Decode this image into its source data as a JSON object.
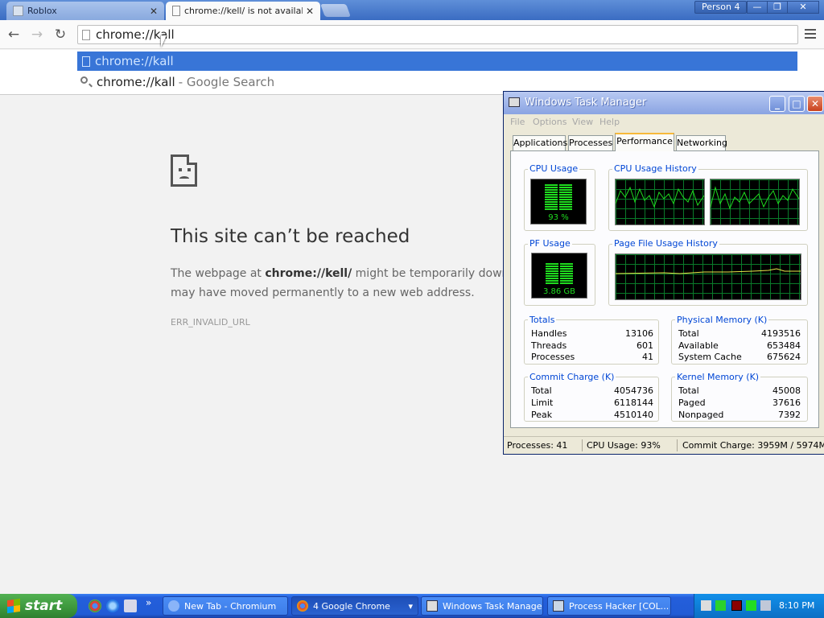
{
  "browser": {
    "tabs": [
      {
        "title": "Roblox",
        "active": false
      },
      {
        "title": "chrome://kell/ is not available",
        "active": true
      }
    ],
    "profile": "Person 4",
    "window_buttons": {
      "minimize": "—",
      "restore": "❐",
      "close": "✕"
    },
    "nav": {
      "back": "←",
      "forward": "→",
      "reload": "↻"
    },
    "omnibox_value": "chrome://kall",
    "suggestions": [
      {
        "text": "chrome://kall",
        "suffix": ""
      },
      {
        "text": "chrome://kall",
        "suffix": "- Google Search"
      }
    ]
  },
  "error_page": {
    "title": "This site can’t be reached",
    "body_prefix": "The webpage at ",
    "url": "chrome://kell/",
    "body_suffix": " might be temporarily down or it may have moved permanently to a new web address.",
    "code": "ERR_INVALID_URL"
  },
  "task_manager": {
    "title": "Windows Task Manager",
    "menu": [
      "File",
      "Options",
      "View",
      "Help"
    ],
    "tabs": [
      "Applications",
      "Processes",
      "Performance",
      "Networking"
    ],
    "active_tab": "Performance",
    "cpu_usage_title": "CPU Usage",
    "cpu_usage_value": "93 %",
    "cpu_history_title": "CPU Usage History",
    "pf_usage_title": "PF Usage",
    "pf_usage_value": "3.86 GB",
    "pf_history_title": "Page File Usage History",
    "totals": {
      "title": "Totals",
      "rows": [
        {
          "label": "Handles",
          "value": "13106"
        },
        {
          "label": "Threads",
          "value": "601"
        },
        {
          "label": "Processes",
          "value": "41"
        }
      ]
    },
    "physical_memory": {
      "title": "Physical Memory (K)",
      "rows": [
        {
          "label": "Total",
          "value": "4193516"
        },
        {
          "label": "Available",
          "value": "653484"
        },
        {
          "label": "System Cache",
          "value": "675624"
        }
      ]
    },
    "commit_charge": {
      "title": "Commit Charge (K)",
      "rows": [
        {
          "label": "Total",
          "value": "4054736"
        },
        {
          "label": "Limit",
          "value": "6118144"
        },
        {
          "label": "Peak",
          "value": "4510140"
        }
      ]
    },
    "kernel_memory": {
      "title": "Kernel Memory (K)",
      "rows": [
        {
          "label": "Total",
          "value": "45008"
        },
        {
          "label": "Paged",
          "value": "37616"
        },
        {
          "label": "Nonpaged",
          "value": "7392"
        }
      ]
    },
    "status": {
      "processes": "Processes: 41",
      "cpu": "CPU Usage: 93%",
      "commit": "Commit Charge: 3959M / 5974M"
    }
  },
  "taskbar": {
    "start_label": "start",
    "overflow": "»",
    "tasks": [
      {
        "label": "New Tab - Chromium",
        "pressed": false
      },
      {
        "label": "4 Google Chrome",
        "pressed": true
      },
      {
        "label": "Windows Task Manager",
        "pressed": false
      },
      {
        "label": "Process Hacker [COL...",
        "pressed": false
      }
    ],
    "group_arrow": "▾",
    "clock": "8:10 PM"
  },
  "colors": {
    "chrome_selected": "#3875d7",
    "graph_green": "#1fdc1f",
    "xp_blue": "#245edb",
    "start_green": "#3c963c"
  }
}
